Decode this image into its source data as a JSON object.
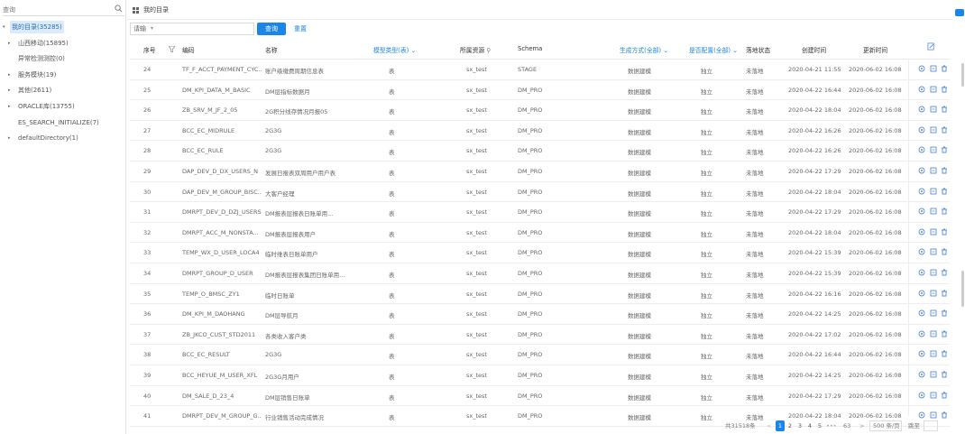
{
  "sidebar": {
    "search_placeholder": "查询",
    "tree": [
      {
        "label": "我的目录(35285)",
        "level": "root",
        "caret": "▾"
      },
      {
        "label": "山西移动(15895)",
        "level": "child",
        "caret": "▸"
      },
      {
        "label": "异常检测测控(0)",
        "level": "leaf",
        "caret": ""
      },
      {
        "label": "服务模块(19)",
        "level": "child",
        "caret": "▸"
      },
      {
        "label": "其他(2611)",
        "level": "child",
        "caret": "▸"
      },
      {
        "label": "ORACLE库(13755)",
        "level": "child",
        "caret": "▸"
      },
      {
        "label": "ES_SEARCH_INITIALIZE(7)",
        "level": "leaf",
        "caret": ""
      },
      {
        "label": "defaultDirectory(1)",
        "level": "child",
        "caret": "▸"
      }
    ]
  },
  "header": {
    "title": "我的目录"
  },
  "filter": {
    "select_value": "请输",
    "query_label": "查询",
    "reset_label": "重置"
  },
  "table": {
    "columns": {
      "index": "序号",
      "code": "编码",
      "name": "名称",
      "type": "模型类型(表)",
      "source": "所属资源",
      "schema": "Schema",
      "gen": "生成方式(全部)",
      "status_a": "是否配置(全部)",
      "status_b": "落地状态",
      "created": "创建时间",
      "updated": "更新时间"
    },
    "rows": [
      {
        "idx": "24",
        "code": "TF_F_ACCT_PAYMENT_CYC...",
        "name": "账户级缴费周期信息表",
        "type": "表",
        "source": "sx_test",
        "schema": "STAGE",
        "gen": "数据建模",
        "cfg": "独立",
        "land": "未落地",
        "created": "2020-04-21 11:55",
        "updated": "2020-06-02 16:08"
      },
      {
        "idx": "25",
        "code": "DM_KPI_DATA_M_BASIC",
        "name": "DM层指标数据月",
        "type": "表",
        "source": "sx_test",
        "schema": "DM_PRO",
        "gen": "数据建模",
        "cfg": "独立",
        "land": "未落地",
        "created": "2020-04-22 16:44",
        "updated": "2020-06-02 16:08"
      },
      {
        "idx": "26",
        "code": "ZB_SRV_M_JF_2_05",
        "name": "2G积分线存情况月报05",
        "type": "表",
        "source": "sx_test",
        "schema": "DM_PRO",
        "gen": "数据建模",
        "cfg": "独立",
        "land": "未落地",
        "created": "2020-04-22 18:04",
        "updated": "2020-06-02 16:08"
      },
      {
        "idx": "27",
        "code": "BCC_EC_MIDRULE",
        "name": "2G3G",
        "type": "表",
        "source": "sx_test",
        "schema": "DM_PRO",
        "gen": "数据建模",
        "cfg": "独立",
        "land": "未落地",
        "created": "2020-04-22 16:26",
        "updated": "2020-06-02 16:08"
      },
      {
        "idx": "28",
        "code": "BCC_EC_RULE",
        "name": "2G3G",
        "type": "表",
        "source": "sx_test",
        "schema": "DM_PRO",
        "gen": "数据建模",
        "cfg": "独立",
        "land": "未落地",
        "created": "2020-04-22 16:26",
        "updated": "2020-06-02 16:08"
      },
      {
        "idx": "29",
        "code": "DAP_DEV_D_DX_USERS_N",
        "name": "发展日报表双周用户用户表",
        "type": "表",
        "source": "sx_test",
        "schema": "DM_PRO",
        "gen": "数据建模",
        "cfg": "独立",
        "land": "未落地",
        "created": "2020-04-22 17:29",
        "updated": "2020-06-02 16:08"
      },
      {
        "idx": "30",
        "code": "DAP_DEV_M_GROUP_BISC...",
        "name": "大客户经理",
        "type": "表",
        "source": "sx_test",
        "schema": "DM_PRO",
        "gen": "数据建模",
        "cfg": "独立",
        "land": "未落地",
        "created": "2020-04-22 18:04",
        "updated": "2020-06-02 16:08"
      },
      {
        "idx": "31",
        "code": "DMRPT_DEV_D_DZJ_USERS",
        "name": "DM报表层报表日账单用...",
        "type": "表",
        "source": "sx_test",
        "schema": "DM_PRO",
        "gen": "数据建模",
        "cfg": "独立",
        "land": "未落地",
        "created": "2020-04-22 17:29",
        "updated": "2020-06-02 16:08"
      },
      {
        "idx": "32",
        "code": "DMRPT_ACC_M_NONSTA...",
        "name": "DM报表层报表用户",
        "type": "表",
        "source": "sx_test",
        "schema": "DM_PRO",
        "gen": "数据建模",
        "cfg": "独立",
        "land": "未落地",
        "created": "2020-04-22 18:04",
        "updated": "2020-06-02 16:08"
      },
      {
        "idx": "33",
        "code": "TEMP_WX_D_USER_LOCA4",
        "name": "临时维表日账单用户",
        "type": "表",
        "source": "sx_test",
        "schema": "DM_PRO",
        "gen": "数据建模",
        "cfg": "独立",
        "land": "未落地",
        "created": "2020-04-22 15:39",
        "updated": "2020-06-02 16:08"
      },
      {
        "idx": "34",
        "code": "DMRPT_GROUP_D_USER",
        "name": "DM报表层报表集团日账单用...",
        "type": "表",
        "source": "sx_test",
        "schema": "DM_PRO",
        "gen": "数据建模",
        "cfg": "独立",
        "land": "未落地",
        "created": "2020-04-22 15:39",
        "updated": "2020-06-02 16:08"
      },
      {
        "idx": "35",
        "code": "TEMP_O_BMSC_ZY1",
        "name": "临时日账单",
        "type": "表",
        "source": "sx_test",
        "schema": "DM_PRO",
        "gen": "数据建模",
        "cfg": "独立",
        "land": "未落地",
        "created": "2020-04-22 16:16",
        "updated": "2020-06-02 16:08"
      },
      {
        "idx": "36",
        "code": "DM_KPI_M_DAOHANG",
        "name": "DM层导航月",
        "type": "表",
        "source": "sx_test",
        "schema": "DM_PRO",
        "gen": "数据建模",
        "cfg": "独立",
        "land": "未落地",
        "created": "2020-04-22 14:25",
        "updated": "2020-06-02 16:08"
      },
      {
        "idx": "37",
        "code": "ZB_JKCO_CUST_STD2011",
        "name": "各类收入客户类",
        "type": "表",
        "source": "sx_test",
        "schema": "DM_PRO",
        "gen": "数据建模",
        "cfg": "独立",
        "land": "未落地",
        "created": "2020-04-22 17:02",
        "updated": "2020-06-02 16:08"
      },
      {
        "idx": "38",
        "code": "BCC_EC_RESULT",
        "name": "2G3G",
        "type": "表",
        "source": "sx_test",
        "schema": "DM_PRO",
        "gen": "数据建模",
        "cfg": "独立",
        "land": "未落地",
        "created": "2020-04-22 16:44",
        "updated": "2020-06-02 16:08"
      },
      {
        "idx": "39",
        "code": "BCC_HEYUE_M_USER_XFL",
        "name": "2G3G月用户",
        "type": "表",
        "source": "sx_test",
        "schema": "DM_PRO",
        "gen": "数据建模",
        "cfg": "独立",
        "land": "未落地",
        "created": "2020-04-22 14:25",
        "updated": "2020-06-02 16:08"
      },
      {
        "idx": "40",
        "code": "DM_SALE_D_23_4",
        "name": "DM层销售日账单",
        "type": "表",
        "source": "sx_test",
        "schema": "DM_PRO",
        "gen": "数据建模",
        "cfg": "独立",
        "land": "未落地",
        "created": "2020-04-22 17:29",
        "updated": "2020-06-02 16:08"
      },
      {
        "idx": "41",
        "code": "DMRPT_DEV_M_GROUP_G...",
        "name": "行业销售活动完成情况",
        "type": "表",
        "source": "sx_test",
        "schema": "DM_PRO",
        "gen": "数据建模",
        "cfg": "独立",
        "land": "未落地",
        "created": "2020-04-22 18:04",
        "updated": "2020-06-02 16:08"
      }
    ]
  },
  "pagination": {
    "total": "共31518条",
    "prev": "<",
    "pages": [
      "1",
      "2",
      "3",
      "4",
      "5"
    ],
    "ellipsis": "•••",
    "last": "63",
    "next": ">",
    "page_size": "500 条/页",
    "jump": "跳至"
  },
  "colors": {
    "accent": "#1a87e8",
    "selected_bg": "#dcebfb"
  },
  "icons": [
    "search-icon",
    "grid-icon",
    "filter-icon",
    "export-icon",
    "view-icon",
    "edit-icon",
    "delete-icon"
  ]
}
